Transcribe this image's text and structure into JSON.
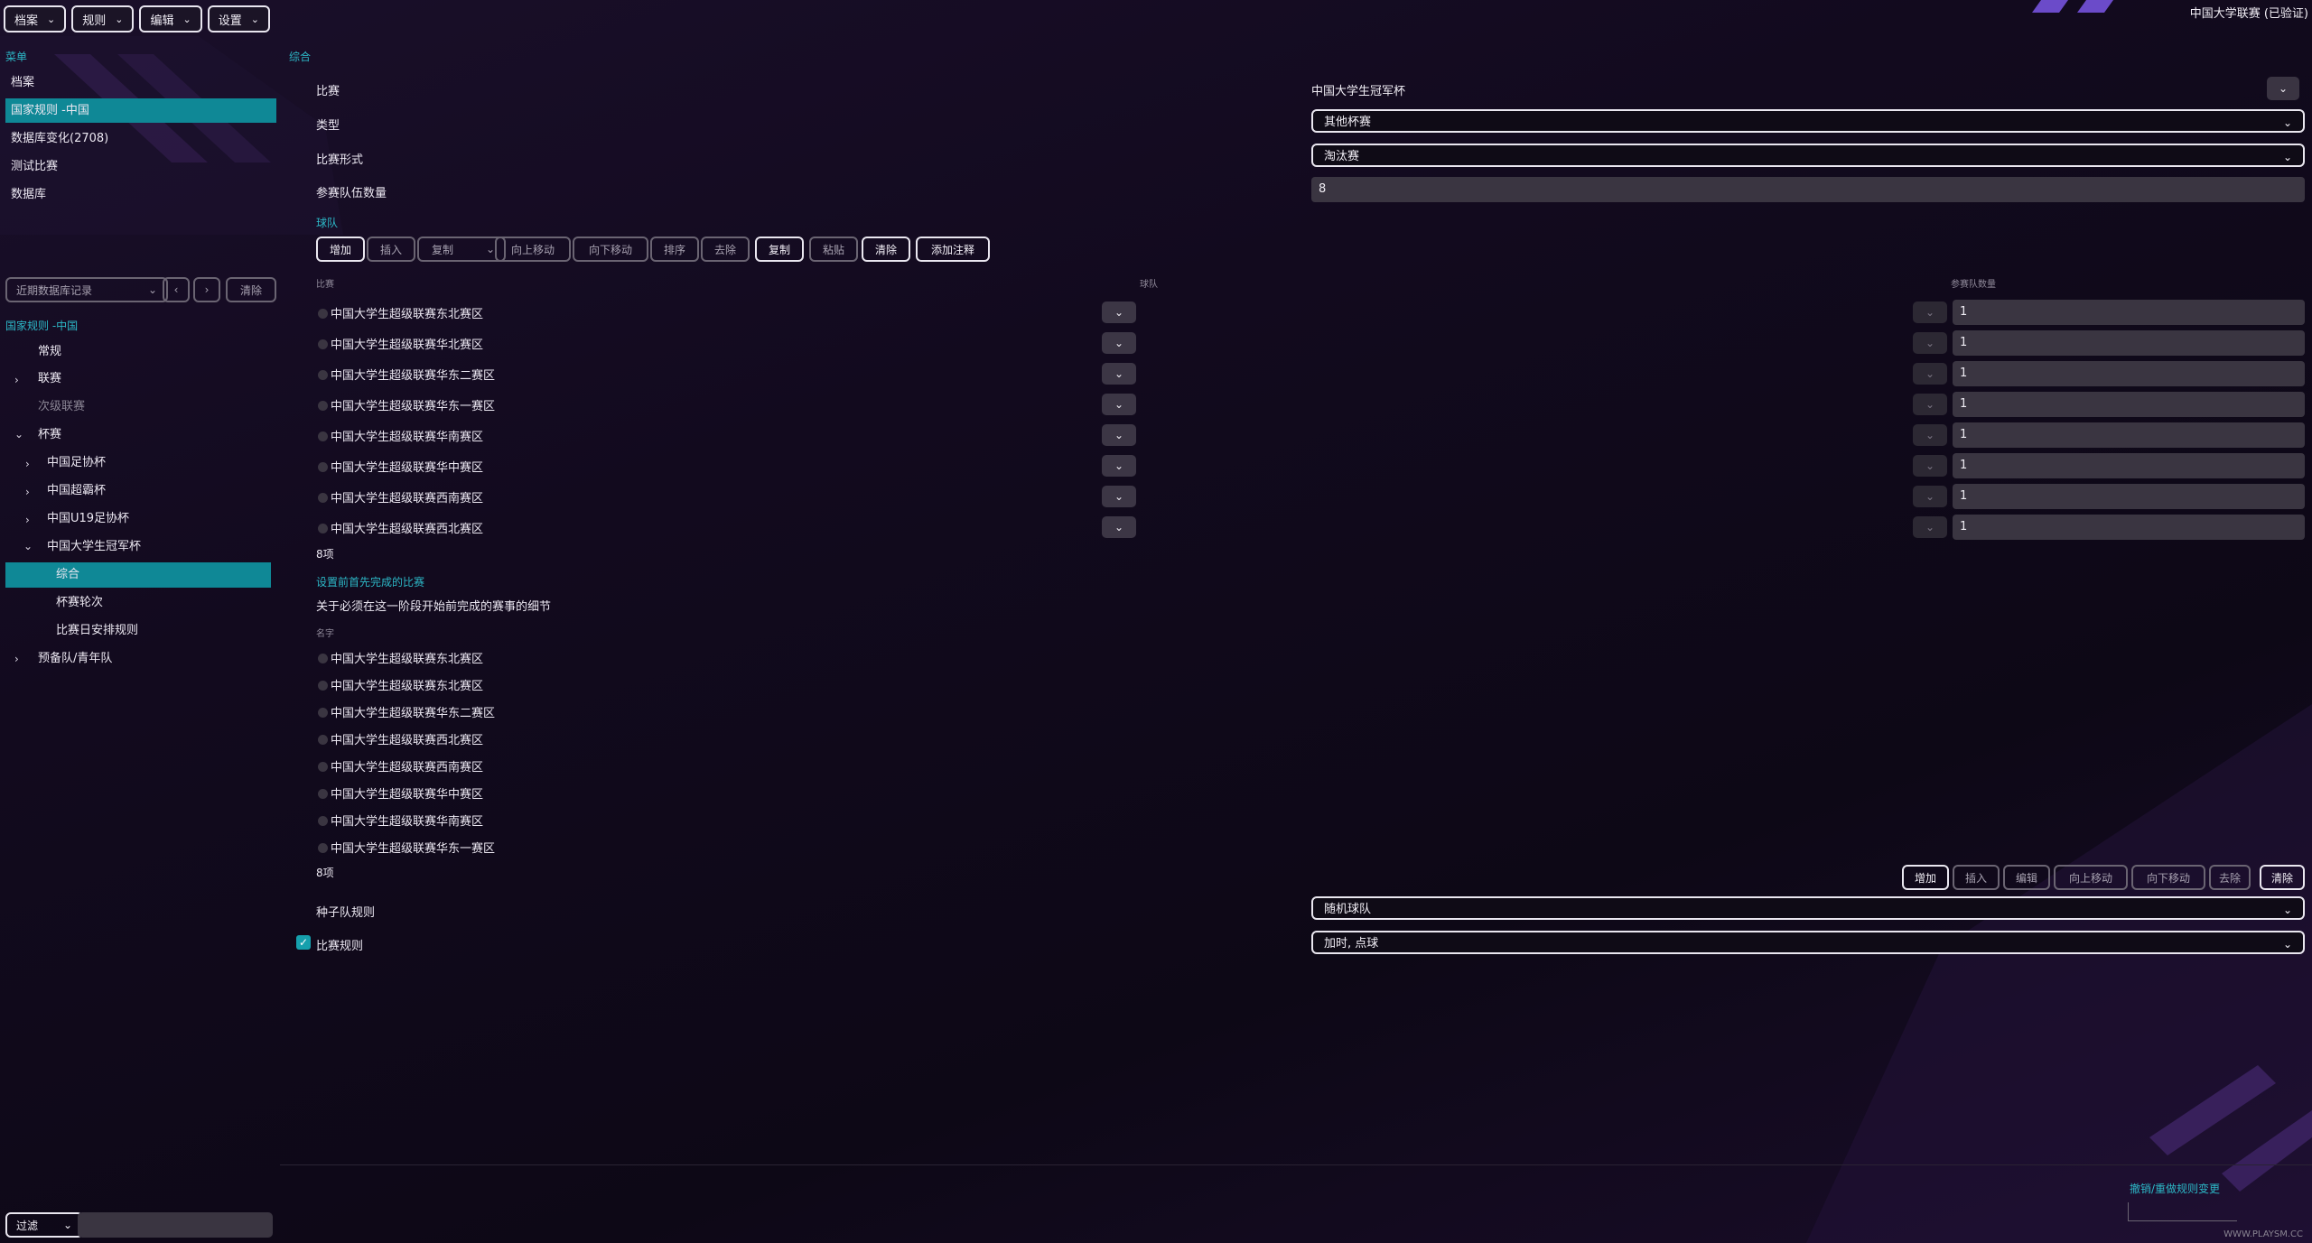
{
  "colors": {
    "accent": "#0f8896",
    "accent_text": "#2cb8c7",
    "background": "#120a1e",
    "purple": "#6b4bc9"
  },
  "topbar": {
    "menus": [
      {
        "label": "档案",
        "icon": "chevron-down-icon"
      },
      {
        "label": "规则",
        "icon": "chevron-down-icon"
      },
      {
        "label": "编辑",
        "icon": "chevron-down-icon"
      },
      {
        "label": "设置",
        "icon": "chevron-down-icon"
      }
    ],
    "right_title": "中国大学联赛 (已验证)"
  },
  "sidebar": {
    "menu_heading": "菜单",
    "items": [
      {
        "label": "档案",
        "active": false
      },
      {
        "label": "国家规则 -中国",
        "active": true
      },
      {
        "label": "数据库变化(2708)",
        "active": false
      },
      {
        "label": "测试比赛",
        "active": false
      },
      {
        "label": "数据库",
        "active": false
      }
    ],
    "history": {
      "placeholder": "近期数据库记录",
      "clear_label": "清除"
    },
    "tree_heading": "国家规则 -中国",
    "tree": [
      {
        "label": "常规",
        "level": 0,
        "chevron": ""
      },
      {
        "label": "联赛",
        "level": 0,
        "chevron": "›"
      },
      {
        "label": "次级联赛",
        "level": 0,
        "chevron": "",
        "dim": true
      },
      {
        "label": "杯赛",
        "level": 0,
        "chevron": "⌄"
      },
      {
        "label": "中国足协杯",
        "level": 1,
        "chevron": "›"
      },
      {
        "label": "中国超霸杯",
        "level": 1,
        "chevron": "›"
      },
      {
        "label": "中国U19足协杯",
        "level": 1,
        "chevron": "›"
      },
      {
        "label": "中国大学生冠军杯",
        "level": 1,
        "chevron": "⌄"
      },
      {
        "label": "综合",
        "level": 2,
        "chevron": "",
        "active": true
      },
      {
        "label": "杯赛轮次",
        "level": 2,
        "chevron": ""
      },
      {
        "label": "比赛日安排规则",
        "level": 2,
        "chevron": ""
      },
      {
        "label": "预备队/青年队",
        "level": 0,
        "chevron": "›"
      }
    ],
    "filter_label": "过滤"
  },
  "main": {
    "section_title": "综合",
    "fields": {
      "competition_label": "比赛",
      "competition_value": "中国大学生冠军杯",
      "type_label": "类型",
      "type_value": "其他杯赛",
      "format_label": "比赛形式",
      "format_value": "淘汰赛",
      "teams_count_label": "参赛队伍数量",
      "teams_count_value": "8"
    },
    "teams_section": {
      "title": "球队",
      "toolbar": [
        {
          "label": "增加",
          "enabled": true
        },
        {
          "label": "插入",
          "enabled": false
        },
        {
          "label": "复制",
          "enabled": false,
          "dropdown": true
        },
        {
          "label": "向上移动",
          "enabled": false
        },
        {
          "label": "向下移动",
          "enabled": false
        },
        {
          "label": "排序",
          "enabled": false
        },
        {
          "label": "去除",
          "enabled": false
        },
        {
          "label": "复制",
          "enabled": true
        },
        {
          "label": "粘贴",
          "enabled": false
        },
        {
          "label": "清除",
          "enabled": true
        },
        {
          "label": "添加注释",
          "enabled": true
        }
      ],
      "columns": [
        "比赛",
        "球队",
        "参赛队数量"
      ],
      "rows": [
        {
          "competition": "中国大学生超级联赛东北赛区",
          "count": "1"
        },
        {
          "competition": "中国大学生超级联赛华北赛区",
          "count": "1"
        },
        {
          "competition": "中国大学生超级联赛华东二赛区",
          "count": "1"
        },
        {
          "competition": "中国大学生超级联赛华东一赛区",
          "count": "1"
        },
        {
          "competition": "中国大学生超级联赛华南赛区",
          "count": "1"
        },
        {
          "competition": "中国大学生超级联赛华中赛区",
          "count": "1"
        },
        {
          "competition": "中国大学生超级联赛西南赛区",
          "count": "1"
        },
        {
          "competition": "中国大学生超级联赛西北赛区",
          "count": "1"
        }
      ],
      "count_text": "8项"
    },
    "prereq_section": {
      "title": "设置前首先完成的比赛",
      "description": "关于必须在这一阶段开始前完成的赛事的细节",
      "column": "名字",
      "rows": [
        "中国大学生超级联赛东北赛区",
        "中国大学生超级联赛东北赛区",
        "中国大学生超级联赛华东二赛区",
        "中国大学生超级联赛西北赛区",
        "中国大学生超级联赛西南赛区",
        "中国大学生超级联赛华中赛区",
        "中国大学生超级联赛华南赛区",
        "中国大学生超级联赛华东一赛区"
      ],
      "count_text": "8项",
      "toolbar": [
        {
          "label": "增加",
          "enabled": true
        },
        {
          "label": "插入",
          "enabled": false
        },
        {
          "label": "编辑",
          "enabled": false
        },
        {
          "label": "向上移动",
          "enabled": false
        },
        {
          "label": "向下移动",
          "enabled": false
        },
        {
          "label": "去除",
          "enabled": false
        },
        {
          "label": "清除",
          "enabled": true
        }
      ]
    },
    "seed_rule_label": "种子队规则",
    "seed_rule_value": "随机球队",
    "match_rules_label": "比赛规则",
    "match_rules_checked": true,
    "match_rules_value": "加时, 点球",
    "undo_link": "撤销/重做规则变更"
  },
  "watermark": "WWW.PLAYSM.CC"
}
